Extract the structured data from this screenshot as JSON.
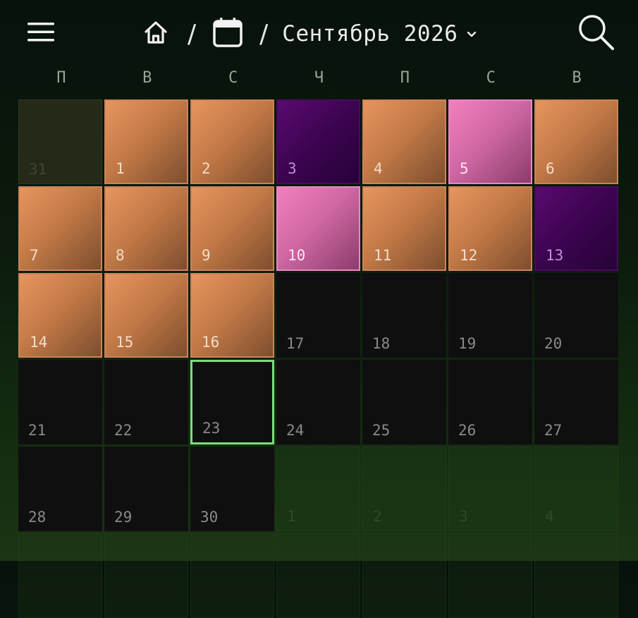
{
  "header": {
    "menu_icon": "hamburger-menu-icon",
    "home_icon": "home-icon",
    "calendar_icon": "calendar-icon",
    "separator": "/",
    "month_label": "Сентябрь 2026",
    "dropdown_icon": "chevron-down-icon",
    "search_icon": "search-icon"
  },
  "weekdays": [
    "П",
    "В",
    "С",
    "Ч",
    "П",
    "С",
    "В"
  ],
  "colors": {
    "orange": "#d88a55",
    "pink": "#e97bb8",
    "purple": "#420557",
    "today_outline": "#7bdc7b",
    "empty_day": "#0f0f10"
  },
  "days": [
    {
      "label": "31",
      "kind": "outside"
    },
    {
      "label": "1",
      "kind": "orange"
    },
    {
      "label": "2",
      "kind": "orange"
    },
    {
      "label": "3",
      "kind": "purple"
    },
    {
      "label": "4",
      "kind": "orange"
    },
    {
      "label": "5",
      "kind": "pink"
    },
    {
      "label": "6",
      "kind": "orange"
    },
    {
      "label": "7",
      "kind": "orange"
    },
    {
      "label": "8",
      "kind": "orange"
    },
    {
      "label": "9",
      "kind": "orange"
    },
    {
      "label": "10",
      "kind": "pink"
    },
    {
      "label": "11",
      "kind": "orange"
    },
    {
      "label": "12",
      "kind": "orange"
    },
    {
      "label": "13",
      "kind": "purple"
    },
    {
      "label": "14",
      "kind": "orange"
    },
    {
      "label": "15",
      "kind": "orange"
    },
    {
      "label": "16",
      "kind": "orange"
    },
    {
      "label": "17",
      "kind": "plain"
    },
    {
      "label": "18",
      "kind": "plain"
    },
    {
      "label": "19",
      "kind": "plain"
    },
    {
      "label": "20",
      "kind": "plain"
    },
    {
      "label": "21",
      "kind": "plain"
    },
    {
      "label": "22",
      "kind": "plain"
    },
    {
      "label": "23",
      "kind": "today"
    },
    {
      "label": "24",
      "kind": "plain"
    },
    {
      "label": "25",
      "kind": "plain"
    },
    {
      "label": "26",
      "kind": "plain"
    },
    {
      "label": "27",
      "kind": "plain"
    },
    {
      "label": "28",
      "kind": "plain"
    },
    {
      "label": "29",
      "kind": "plain"
    },
    {
      "label": "30",
      "kind": "plain"
    },
    {
      "label": "1",
      "kind": "outside-next"
    },
    {
      "label": "2",
      "kind": "outside-next"
    },
    {
      "label": "3",
      "kind": "outside-next"
    },
    {
      "label": "4",
      "kind": "outside-next"
    }
  ]
}
